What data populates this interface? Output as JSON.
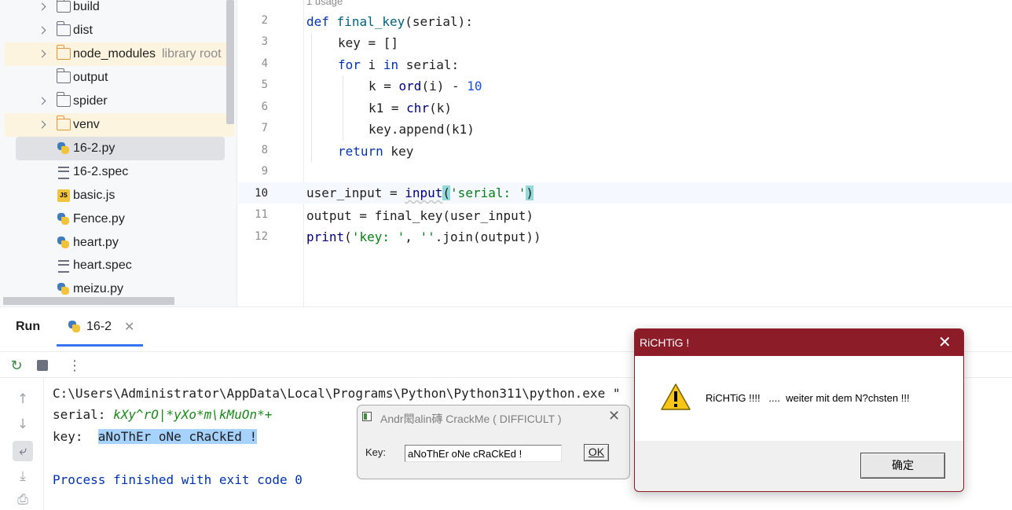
{
  "tree": {
    "items": [
      {
        "label": "build",
        "kind": "folder",
        "expandable": true
      },
      {
        "label": "dist",
        "kind": "folder",
        "expandable": true
      },
      {
        "label": "node_modules",
        "hint": "library root",
        "kind": "folder-excluded",
        "expandable": true
      },
      {
        "label": "output",
        "kind": "folder",
        "expandable": false
      },
      {
        "label": "spider",
        "kind": "folder",
        "expandable": true
      },
      {
        "label": "venv",
        "kind": "folder-excluded",
        "expandable": true
      },
      {
        "label": "16-2.py",
        "kind": "python",
        "selected": true
      },
      {
        "label": "16-2.spec",
        "kind": "text"
      },
      {
        "label": "basic.js",
        "kind": "javascript",
        "icon_text": "JS"
      },
      {
        "label": "Fence.py",
        "kind": "python"
      },
      {
        "label": "heart.py",
        "kind": "python"
      },
      {
        "label": "heart.spec",
        "kind": "text"
      },
      {
        "label": "meizu.py",
        "kind": "python"
      }
    ]
  },
  "editor": {
    "usage_hint": "1 usage",
    "line_numbers": [
      "2",
      "3",
      "4",
      "5",
      "6",
      "7",
      "8",
      "9",
      "10",
      "11",
      "12"
    ],
    "current_line": "10",
    "code": {
      "l2": {
        "kw": "def",
        "fn": "final_key",
        "rest": "(serial):"
      },
      "l3": "key = []",
      "l4": {
        "kw1": "for",
        "mid": " i ",
        "kw2": "in",
        "rest": " serial:"
      },
      "l5": {
        "a": "k = ",
        "b": "ord",
        "c": "(i) - ",
        "d": "10"
      },
      "l6": {
        "a": "k1 = ",
        "b": "chr",
        "c": "(k)"
      },
      "l7": "key.append(k1)",
      "l8": {
        "kw": "return",
        "rest": " key"
      },
      "l10": {
        "a": "user_input = ",
        "b": "input",
        "p1": "(",
        "s": "'serial: '",
        "p2": ")"
      },
      "l11": "output = final_key(user_input)",
      "l12": {
        "b": "print",
        "a": "(",
        "s1": "'key: '",
        "c": ", ",
        "s2": "''",
        "d": ".join(output))"
      }
    }
  },
  "run": {
    "title": "Run",
    "tab_label": "16-2",
    "console": {
      "cmd": "C:\\Users\\Administrator\\AppData\\Local\\Programs\\Python\\Python311\\python.exe \"",
      "serial_prompt": "serial: ",
      "serial_input": "kXy^rO|*yXo*m\\kMuOn*+",
      "key_prompt": "key:  ",
      "key_output": "aNoThEr oNe cRaCkEd !",
      "exit_msg": "Process finished with exit code 0"
    }
  },
  "crackme": {
    "title": "Andr閎alin磚 CrackMe  ( DIFFICULT )",
    "key_label": "Key:",
    "key_value": "aNoThEr oNe cRaCkEd !",
    "ok_label": "OK"
  },
  "richtig": {
    "title": "RiCHTiG !",
    "message": "RiCHTiG !!!!   ....  weiter mit dem N?chsten !!!",
    "ok_label": "确定",
    "titlebar_color": "#8b1c28"
  }
}
